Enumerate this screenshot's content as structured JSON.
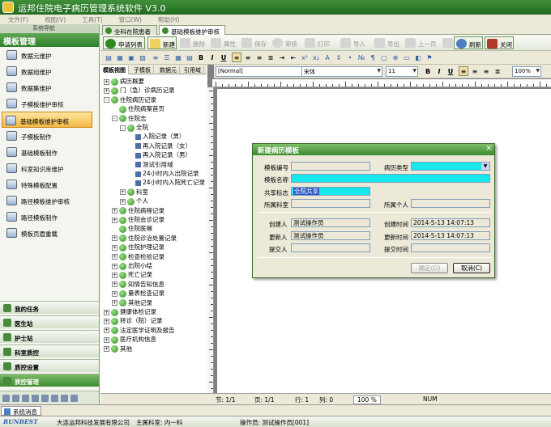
{
  "window": {
    "title": "运邦住院电子病历管理系统软件 V3.0"
  },
  "menu": [
    "文件(F)",
    "视图(V)",
    "工具(T)",
    "窗口(W)",
    "帮助(H)"
  ],
  "sidebar": {
    "header": "系统导航",
    "title": "模板管理",
    "items": [
      "数据元维护",
      "数据组维护",
      "数据集维护",
      "子模板维护审核",
      "基础模板维护审核",
      "子模板制作",
      "基础模板制作",
      "科室知识库维护",
      "特殊模板配置",
      "路径模板维护审核",
      "路径模板制作",
      "模板页眉重载"
    ],
    "active_index": 4,
    "sections": [
      "我的任务",
      "医生站",
      "护士站",
      "科室质控",
      "质控设置",
      "质控管理"
    ]
  },
  "tabs": [
    {
      "label": "全科在院患者"
    },
    {
      "label": "基础模板维护审核"
    }
  ],
  "toolbar": {
    "apply_list": "申请列表",
    "new": "新建",
    "delete": "删除",
    "properties": "属性",
    "save": "保存",
    "audit": "审核",
    "print": "打印",
    "import": "导入",
    "export": "导出",
    "prev": "上一页",
    "next": "下一页",
    "refresh": "刷新",
    "close": "关闭"
  },
  "format_bar": {
    "style": "[Normal]",
    "font": "宋体",
    "size": "11",
    "zoom": "100%"
  },
  "tree_tabs": [
    "模板视图",
    "子模板",
    "数据元",
    "引用域"
  ],
  "tree": [
    {
      "label": "病历概要",
      "level": 0,
      "ex": "+"
    },
    {
      "label": "门（急）诊病历记录",
      "level": 0,
      "ex": "+"
    },
    {
      "label": "住院病历记录",
      "level": 0,
      "ex": "-"
    },
    {
      "label": "住院病案首页",
      "level": 1,
      "ex": ""
    },
    {
      "label": "住院志",
      "level": 1,
      "ex": "-"
    },
    {
      "label": "全院",
      "level": 2,
      "ex": "-"
    },
    {
      "label": "入院记录（男）",
      "level": 3,
      "ex": ""
    },
    {
      "label": "再入院记录（女）",
      "level": 3,
      "ex": ""
    },
    {
      "label": "再入院记录（男）",
      "level": 3,
      "ex": ""
    },
    {
      "label": "测试引用域",
      "level": 3,
      "ex": ""
    },
    {
      "label": "24小时内入出院记录",
      "level": 3,
      "ex": ""
    },
    {
      "label": "24小时内入院死亡记录",
      "level": 3,
      "ex": ""
    },
    {
      "label": "科室",
      "level": 2,
      "ex": "+"
    },
    {
      "label": "个人",
      "level": 2,
      "ex": "+"
    },
    {
      "label": "住院病程记录",
      "level": 1,
      "ex": "+"
    },
    {
      "label": "住院会诊记录",
      "level": 1,
      "ex": "+"
    },
    {
      "label": "住院医嘱",
      "level": 1,
      "ex": ""
    },
    {
      "label": "住院诊治处置记录",
      "level": 1,
      "ex": "+"
    },
    {
      "label": "住院护理记录",
      "level": 1,
      "ex": "+"
    },
    {
      "label": "检查检验记录",
      "level": 1,
      "ex": "+"
    },
    {
      "label": "出院小结",
      "level": 1,
      "ex": "+"
    },
    {
      "label": "死亡记录",
      "level": 1,
      "ex": "+"
    },
    {
      "label": "知情告知信息",
      "level": 1,
      "ex": "+"
    },
    {
      "label": "量表检查记录",
      "level": 1,
      "ex": "+"
    },
    {
      "label": "其他记录",
      "level": 1,
      "ex": "+"
    },
    {
      "label": "健康体检记录",
      "level": 0,
      "ex": "+"
    },
    {
      "label": "转诊（院）记录",
      "level": 0,
      "ex": "+"
    },
    {
      "label": "法定医学证明及报告",
      "level": 0,
      "ex": "+"
    },
    {
      "label": "医疗机构信息",
      "level": 0,
      "ex": "+"
    },
    {
      "label": "其他",
      "level": 0,
      "ex": "+"
    }
  ],
  "dialog": {
    "title": "新建病历模板",
    "code_label": "模板编号",
    "code_value": "",
    "type_label": "病历类型",
    "type_value": "",
    "name_label": "模板名称",
    "name_value": "",
    "share_label": "共享标志",
    "share_value": "全院共享",
    "dept_label": "所属科室",
    "dept_value": "",
    "person_label": "所属个人",
    "person_value": "",
    "creator_label": "创建人",
    "creator_value": "测试操作员",
    "create_time_label": "创建时间",
    "create_time_value": "2014-5-13 14:07:13",
    "updater_label": "更新人",
    "updater_value": "测试操作员",
    "update_time_label": "更新时间",
    "update_time_value": "2014-5-13 14:07:13",
    "submitter_label": "提交人",
    "submitter_value": "",
    "submit_time_label": "提交时间",
    "submit_time_value": "",
    "ok": "确定(O)",
    "cancel": "取消(C)"
  },
  "status": {
    "section": "节: 1/1",
    "page": "页: 1/1",
    "row": "行: 1",
    "col": "列: 0",
    "zoom": "100 %",
    "num": "NUM"
  },
  "bottom_tab": "系统消息",
  "footer": {
    "brand": "RUNBEST",
    "company": "大连运邦科技发展有限公司",
    "dept": "主属科室: 内一科",
    "operator": "操作员: 测试操作员[001]"
  },
  "colors": {
    "accent": "#3a8a2c",
    "highlight": "#16e8ec",
    "active": "#f5b844"
  }
}
